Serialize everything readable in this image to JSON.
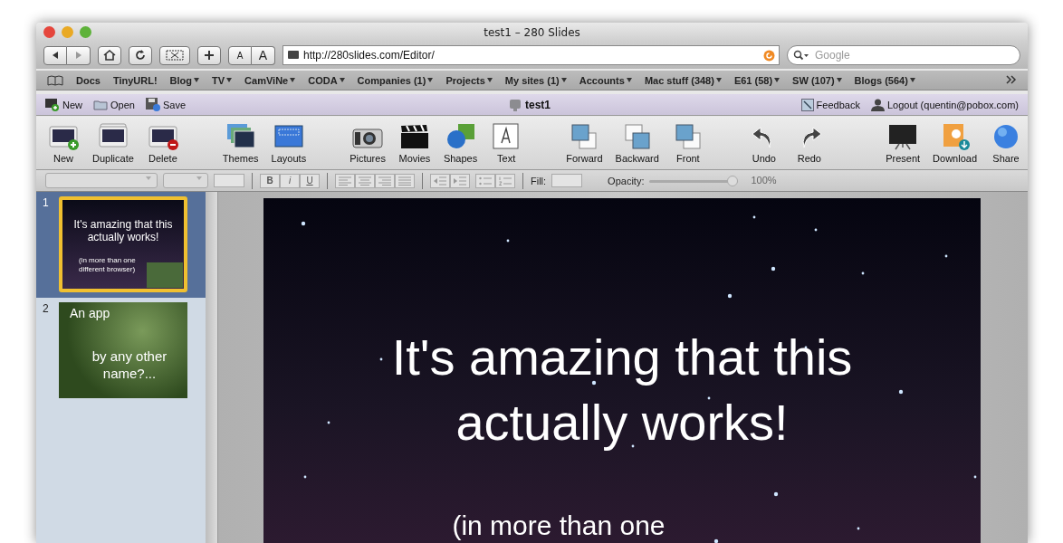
{
  "window": {
    "title": "test1 – 280 Slides"
  },
  "browser_toolbar": {
    "url": "http://280slides.com/Editor/",
    "search": {
      "placeholder": "Google"
    },
    "font_buttons": [
      "A",
      "A"
    ]
  },
  "bookmarks": [
    {
      "label": "Docs",
      "menu": false
    },
    {
      "label": "TinyURL!",
      "menu": false
    },
    {
      "label": "Blog",
      "menu": true
    },
    {
      "label": "TV",
      "menu": true
    },
    {
      "label": "CamViNe",
      "menu": true
    },
    {
      "label": "CODA",
      "menu": true
    },
    {
      "label": "Companies (1)",
      "menu": true
    },
    {
      "label": "Projects",
      "menu": true
    },
    {
      "label": "My sites (1)",
      "menu": true
    },
    {
      "label": "Accounts",
      "menu": true
    },
    {
      "label": "Mac stuff (348)",
      "menu": true
    },
    {
      "label": "E61 (58)",
      "menu": true
    },
    {
      "label": "SW (107)",
      "menu": true
    },
    {
      "label": "Blogs (564)",
      "menu": true
    }
  ],
  "app_header": {
    "file_actions": [
      {
        "label": "New",
        "kind": "new"
      },
      {
        "label": "Open",
        "kind": "open"
      },
      {
        "label": "Save",
        "kind": "save"
      }
    ],
    "document_title": "test1",
    "account_actions": [
      {
        "label": "Feedback",
        "kind": "feedback"
      },
      {
        "label": "Logout (quentin@pobox.com)",
        "kind": "user"
      }
    ]
  },
  "toolbar": [
    [
      {
        "label": "New",
        "kind": "new-slide"
      },
      {
        "label": "Duplicate",
        "kind": "duplicate"
      },
      {
        "label": "Delete",
        "kind": "delete"
      }
    ],
    [
      {
        "label": "Themes",
        "kind": "themes"
      },
      {
        "label": "Layouts",
        "kind": "layouts"
      }
    ],
    [
      {
        "label": "Pictures",
        "kind": "camera"
      },
      {
        "label": "Movies",
        "kind": "clapper"
      },
      {
        "label": "Shapes",
        "kind": "shapes"
      },
      {
        "label": "Text",
        "kind": "text"
      }
    ],
    [
      {
        "label": "Forward",
        "kind": "forward"
      },
      {
        "label": "Backward",
        "kind": "backward"
      },
      {
        "label": "Front",
        "kind": "front"
      }
    ],
    [
      {
        "label": "Undo",
        "kind": "undo"
      },
      {
        "label": "Redo",
        "kind": "redo"
      }
    ],
    [
      {
        "label": "Present",
        "kind": "present"
      },
      {
        "label": "Download",
        "kind": "download"
      },
      {
        "label": "Share",
        "kind": "share"
      }
    ]
  ],
  "format_bar": {
    "disabled": true,
    "style_buttons": [
      "B",
      "i",
      "U"
    ],
    "fill_label": "Fill:",
    "opacity_label": "Opacity:",
    "opacity": {
      "level": 1.0,
      "reading": "100%"
    }
  },
  "slides": [
    {
      "number": "1",
      "selected": true,
      "kind": "stars",
      "title": "It's amazing that this actually works!",
      "subtitle": "(in more than one different browser)"
    },
    {
      "number": "2",
      "selected": false,
      "kind": "photo",
      "title": "An app",
      "subtitle": "by any other name?..."
    }
  ],
  "current_slide": {
    "title": "It's amazing that this actually works!",
    "subtitle": "(in more than one"
  }
}
